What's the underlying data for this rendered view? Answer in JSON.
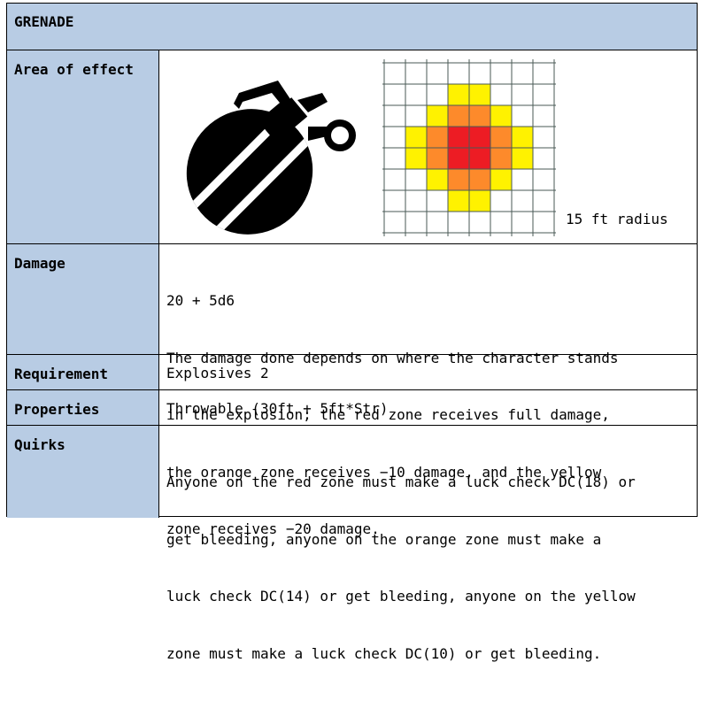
{
  "title": "GRENADE",
  "rows": {
    "area_of_effect": {
      "label": "Area of effect",
      "radius": "15 ft radius",
      "icon": "grenade-icon",
      "zone_colors": {
        "red": "#ed1c24",
        "orange": "#fd8a2b",
        "yellow": "#fff200"
      }
    },
    "damage": {
      "label": "Damage",
      "lines": [
        "20 + 5d6",
        "The damage done depends on where the character stands",
        "in the explosion; the red zone receives full damage,",
        "the orange zone receives −10 damage, and the yellow",
        "zone receives −20 damage."
      ]
    },
    "requirement": {
      "label": "Requirement",
      "value": "Explosives 2"
    },
    "properties": {
      "label": "Properties",
      "value": "Throwable (30ft + 5ft*Str)"
    },
    "quirks": {
      "label": "Quirks",
      "lines": [
        "Anyone on the red zone must make a luck check DC(18) or",
        "get bleeding, anyone on the orange zone must make a",
        "luck check DC(14) or get bleeding, anyone on the yellow",
        "zone must make a luck check DC(10) or get bleeding."
      ]
    }
  },
  "colors": {
    "label_bg": "#b8cce4",
    "border": "#000000"
  }
}
